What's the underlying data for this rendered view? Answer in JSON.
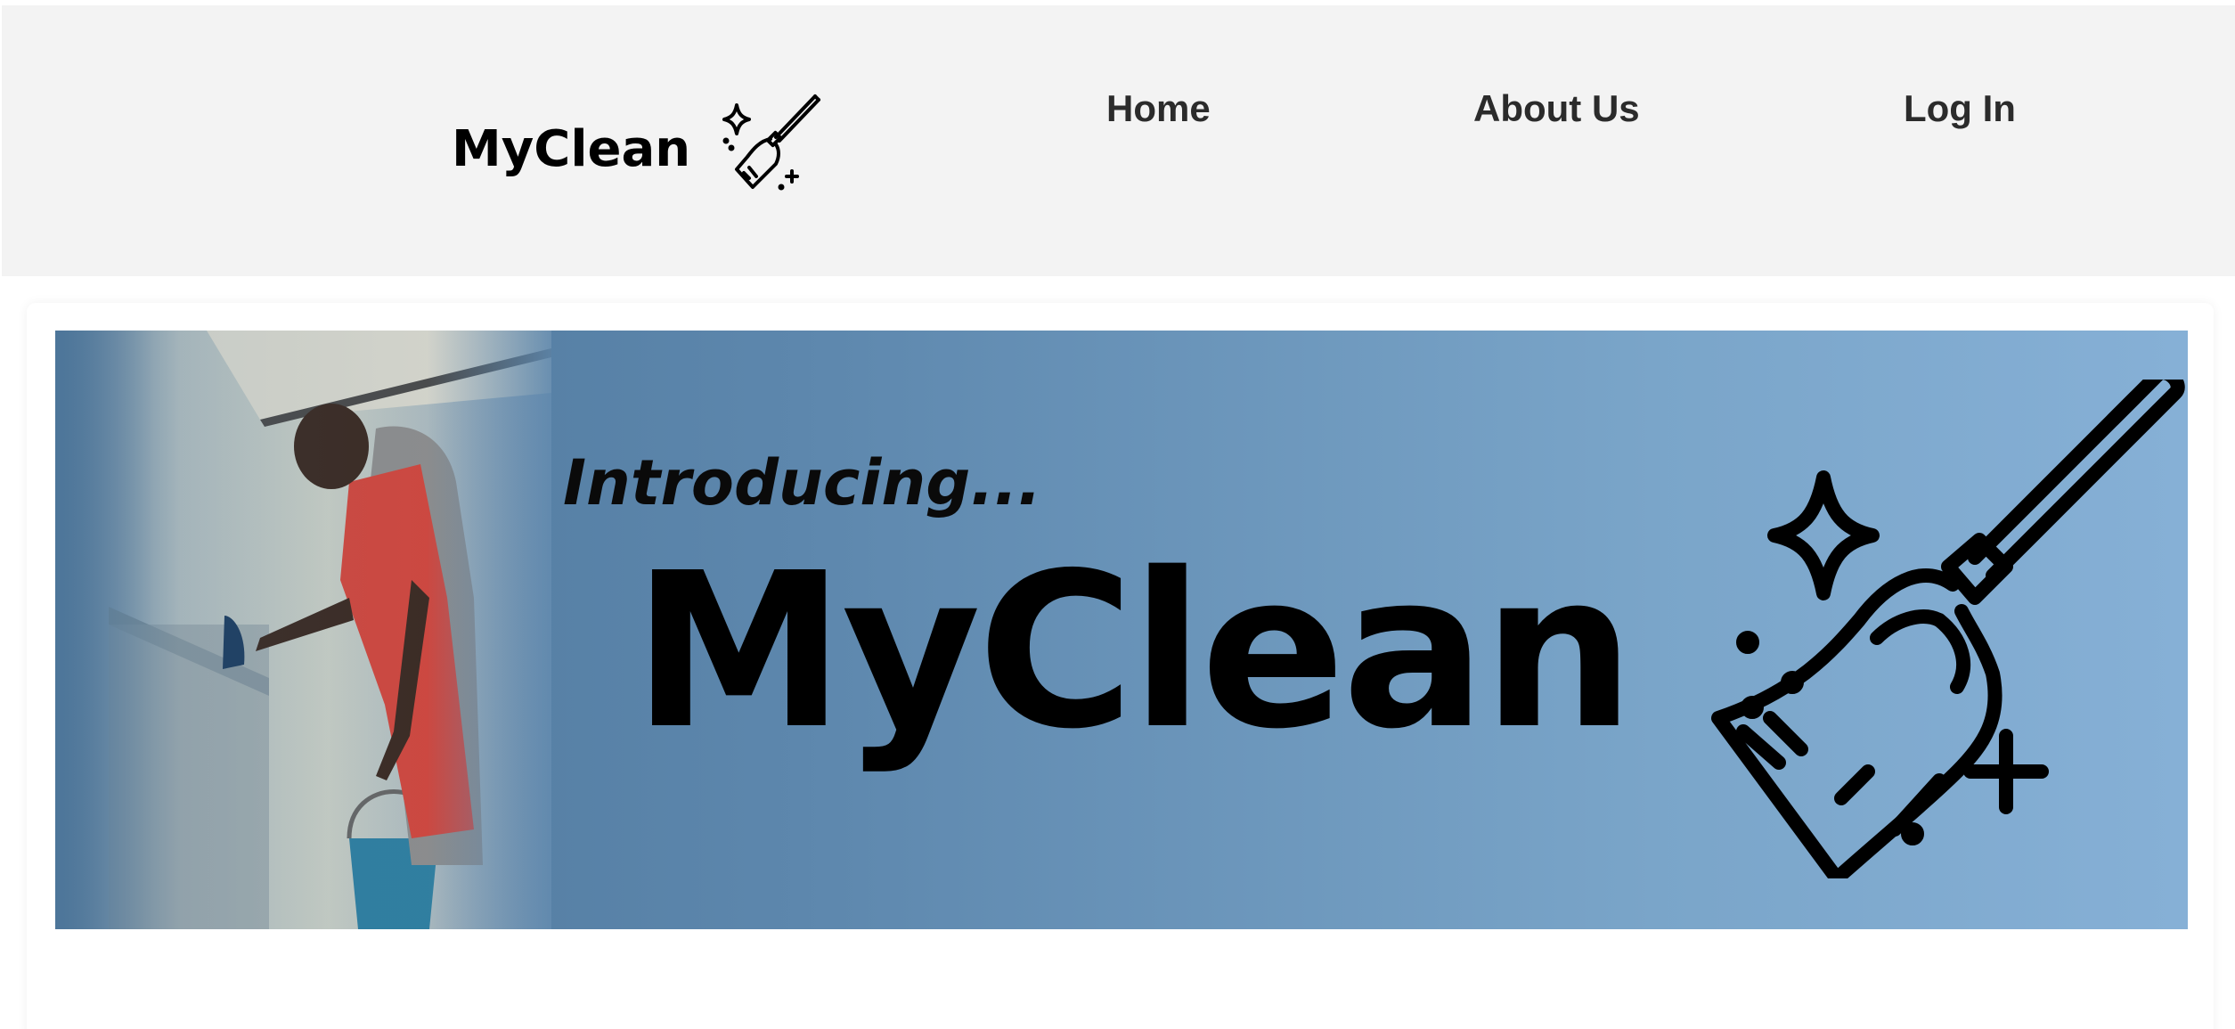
{
  "header": {
    "logo_text": "MyClean",
    "logo_icon": "broom-sparkle-icon",
    "nav": {
      "home": "Home",
      "about": "About Us",
      "login": "Log In"
    }
  },
  "hero": {
    "intro": "Introducing...",
    "brand": "MyClean",
    "photo": "cleaner-photo",
    "icon": "broom-sparkle-icon"
  },
  "colors": {
    "header_bg": "#f3f3f3",
    "banner_start": "#4c7599",
    "banner_end": "#86b0d6",
    "nav_text": "#2b2b2b"
  }
}
